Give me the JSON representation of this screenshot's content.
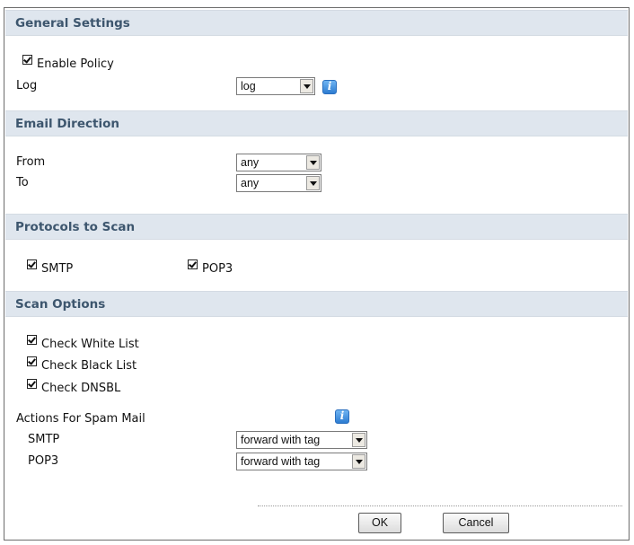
{
  "sections": {
    "general": {
      "title": "General Settings",
      "enable_policy_label": "Enable Policy",
      "log_label": "Log",
      "log_value": "log"
    },
    "email_direction": {
      "title": "Email Direction",
      "from_label": "From",
      "from_value": "any",
      "to_label": "To",
      "to_value": "any"
    },
    "protocols": {
      "title": "Protocols to Scan",
      "smtp_label": "SMTP",
      "pop3_label": "POP3"
    },
    "scan_options": {
      "title": "Scan Options",
      "check_white_list_label": "Check White List",
      "check_black_list_label": "Check Black List",
      "check_dnsbl_label": "Check DNSBL",
      "actions_label": "Actions For Spam Mail",
      "smtp_label": "SMTP",
      "smtp_action": "forward with tag",
      "pop3_label": "POP3",
      "pop3_action": "forward with tag"
    }
  },
  "buttons": {
    "ok": "OK",
    "cancel": "Cancel"
  },
  "checkbox_states": {
    "enable_policy": true,
    "protocol_smtp": true,
    "protocol_pop3": true,
    "check_white_list": true,
    "check_black_list": true,
    "check_dnsbl": true
  },
  "icons": {
    "help": "info-icon"
  },
  "colors": {
    "section_header_bg": "#dfe6ee",
    "section_title": "#3d566e",
    "help_icon": "#2d7cd1"
  }
}
